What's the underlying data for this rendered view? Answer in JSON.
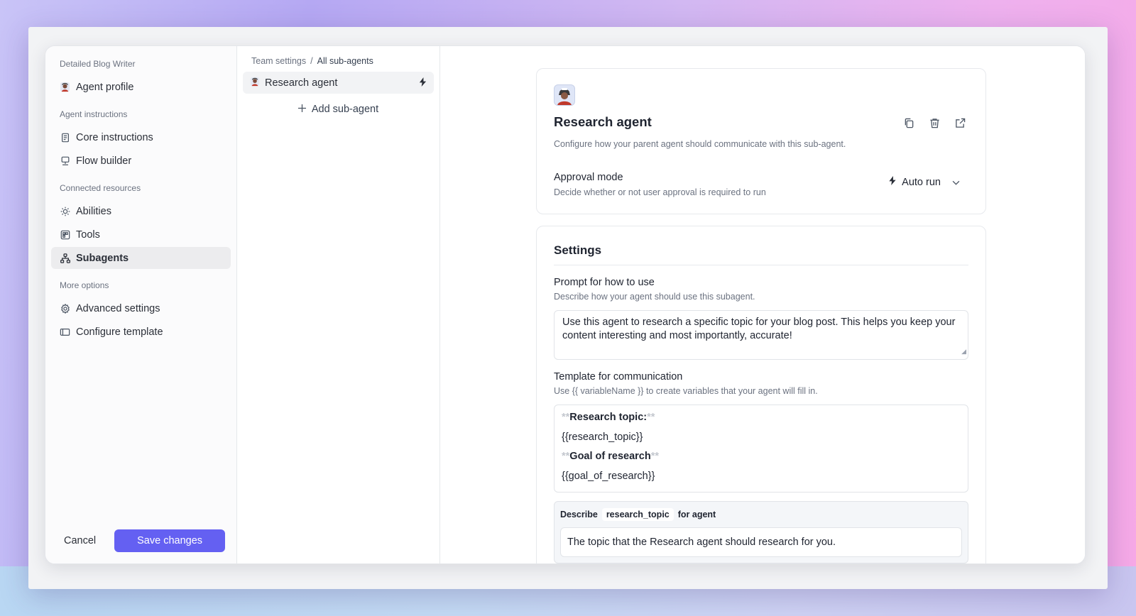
{
  "nav": {
    "agent_name": "Detailed Blog Writer",
    "profile_label": "Agent profile",
    "sections": {
      "instructions": "Agent instructions",
      "resources": "Connected resources",
      "more": "More options"
    },
    "items": {
      "core": "Core instructions",
      "flow": "Flow builder",
      "abilities": "Abilities",
      "tools": "Tools",
      "subagents": "Subagents",
      "advanced": "Advanced settings",
      "template": "Configure template"
    },
    "cancel_label": "Cancel",
    "save_label": "Save changes"
  },
  "list": {
    "breadcrumb": {
      "parent": "Team settings",
      "separator": "/",
      "current": "All sub-agents"
    },
    "agents": [
      {
        "name": "Research agent"
      }
    ],
    "add_label": "Add sub-agent"
  },
  "agent": {
    "title": "Research agent",
    "description": "Configure how your parent agent should communicate with this sub-agent.",
    "approval": {
      "label": "Approval mode",
      "description": "Decide whether or not user approval is required to run",
      "value": "Auto run"
    }
  },
  "settings": {
    "title": "Settings",
    "prompt": {
      "label": "Prompt for how to use",
      "description": "Describe how your agent should use this subagent.",
      "value": "Use this agent to research a specific topic for your blog post. This helps you keep your content interesting and most importantly, accurate!"
    },
    "template": {
      "label": "Template for communication",
      "description": "Use {{ variableName }} to create variables that your agent will fill in.",
      "markers": "**",
      "lines": [
        "Research topic:",
        "{{research_topic}}",
        "Goal of research",
        "{{goal_of_research}}"
      ]
    },
    "describe": {
      "prefix": "Describe",
      "variable": "research_topic",
      "suffix": "for agent",
      "value": "The topic that the Research agent should research for you."
    }
  },
  "colors": {
    "accent": "#6460f2",
    "active_bg": "#ececee"
  }
}
